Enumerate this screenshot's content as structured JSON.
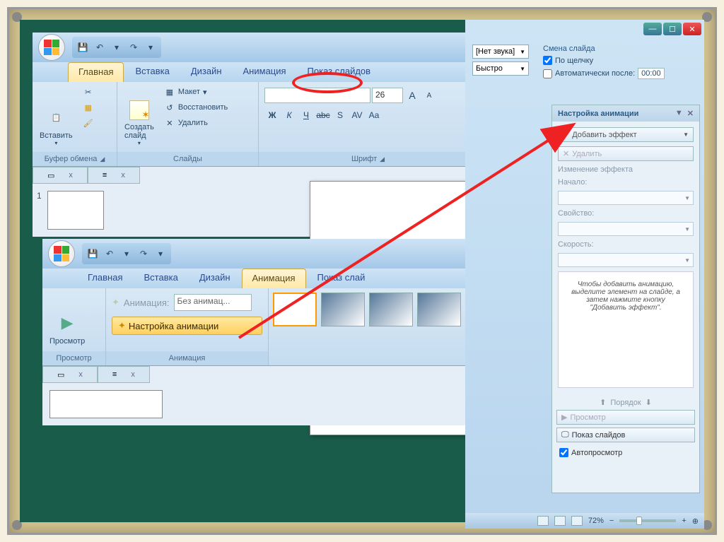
{
  "win1": {
    "tabs": [
      "Главная",
      "Вставка",
      "Дизайн",
      "Анимация",
      "Показ слайдов"
    ],
    "active_tab_index": 0,
    "circled_tab_index": 3,
    "clipboard": {
      "label": "Буфер обмена",
      "paste": "Вставить"
    },
    "slides": {
      "label": "Слайды",
      "new": "Создать\nслайд",
      "layout": "Макет",
      "restore": "Восстановить",
      "delete": "Удалить"
    },
    "font": {
      "label": "Шрифт",
      "size": "26",
      "bold": "Ж",
      "italic": "К",
      "underline": "Ч",
      "strike": "abc",
      "shadow": "S",
      "spacing": "AV",
      "case": "Aa"
    },
    "thumb_close": "x",
    "slide_number": "1"
  },
  "win2": {
    "tabs": [
      "Главная",
      "Вставка",
      "Дизайн",
      "Анимация",
      "Показ слай"
    ],
    "active_tab_index": 3,
    "preview": {
      "label": "Просмотр",
      "btn": "Просмотр"
    },
    "anim_group": {
      "label": "Анимация",
      "anim_label": "Анимация:",
      "anim_value": "Без анимац...",
      "custom": "Настройка анимации"
    },
    "thumb_close": "x"
  },
  "win3": {
    "transition": {
      "sound_label": "[Нет звука]",
      "speed_label": "Быстро",
      "section_title": "Смена слайда",
      "on_click": "По щелчку",
      "auto_after": "Автоматически после:",
      "auto_time": "00:00"
    },
    "taskpane": {
      "title": "Настройка анимации",
      "add_effect": "Добавить эффект",
      "remove": "Удалить",
      "modify": "Изменение эффекта",
      "start": "Начало:",
      "property": "Свойство:",
      "speed": "Скорость:",
      "hint": "Чтобы добавить анимацию, выделите элемент на слайде, а затем нажмите кнопку \"Добавить эффект\".",
      "order": "Порядок",
      "play": "Просмотр",
      "slideshow": "Показ слайдов",
      "autopreview": "Автопросмотр"
    },
    "status": {
      "zoom": "72%"
    }
  }
}
